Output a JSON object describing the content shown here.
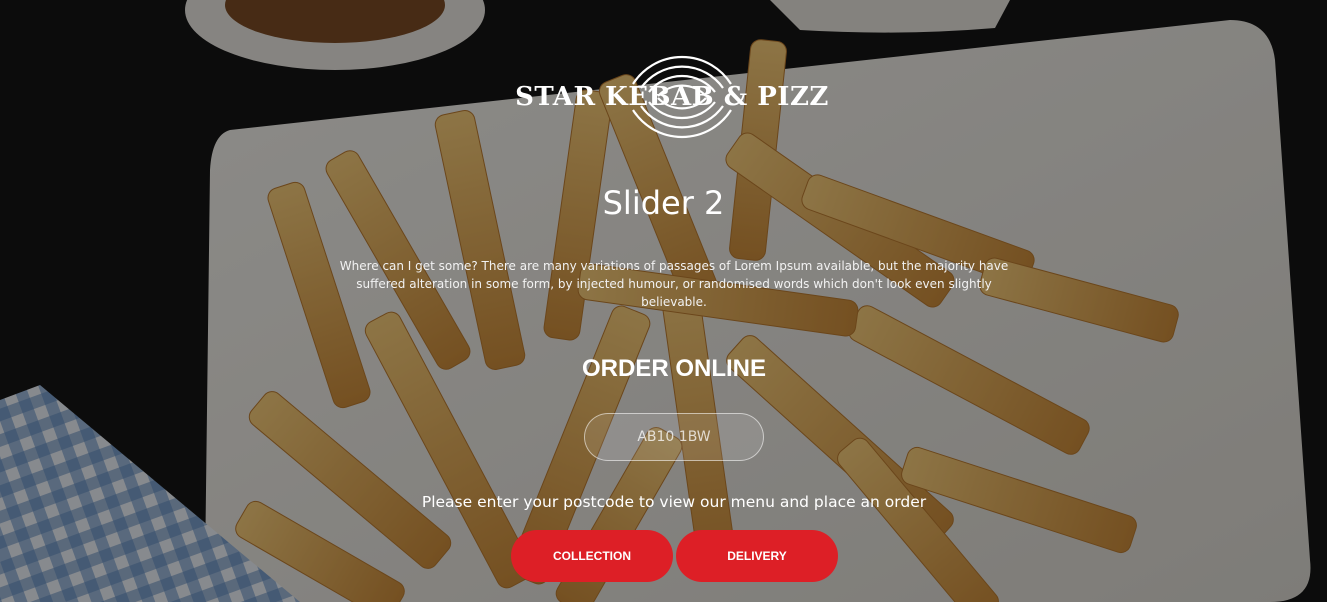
{
  "brand": {
    "name": "STAR KEBAB & PIZZ"
  },
  "slider": {
    "title": "Slider 2",
    "description": "Where can I get some? There are many variations of passages of Lorem Ipsum available, but the majority have suffered alteration in some form, by injected humour, or randomised words which don't look even slightly believable."
  },
  "order": {
    "title": "ORDER ONLINE",
    "postcode_placeholder": "AB10 1BW",
    "postcode_value": "",
    "hint": "Please enter your postcode to view our menu and place an order",
    "collection_label": "COLLECTION",
    "delivery_label": "DELIVERY"
  },
  "colors": {
    "accent": "#dd1f26",
    "overlay": "rgba(0,0,0,0.42)",
    "text": "#ffffff"
  },
  "icons": {
    "logo_emblem": "concentric-arcs-emblem"
  }
}
